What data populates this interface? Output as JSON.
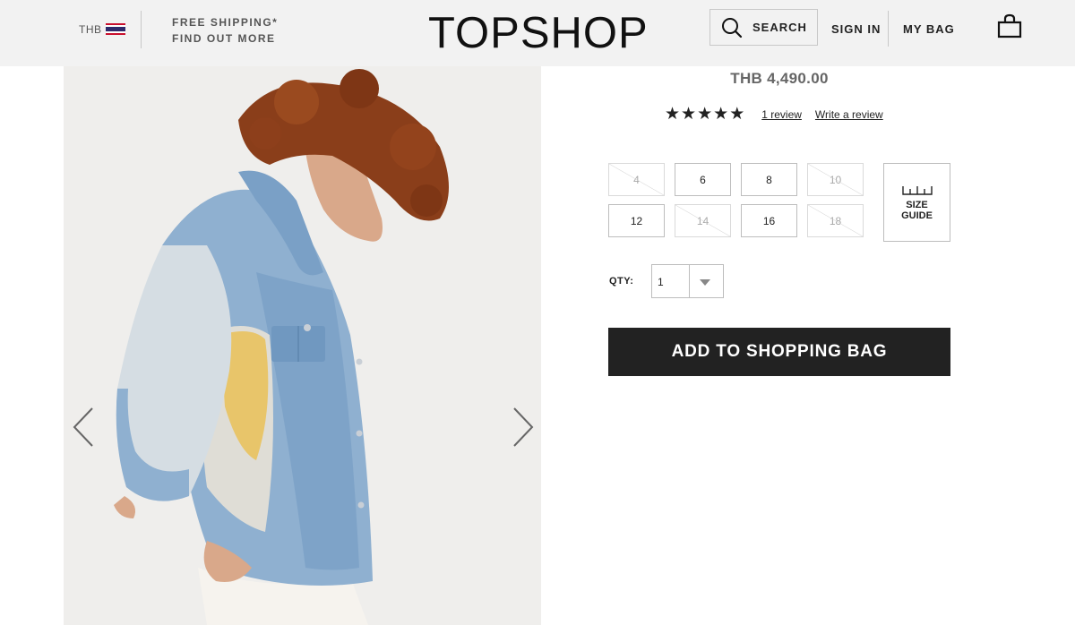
{
  "header": {
    "currency": "THB",
    "shipping_line1": "FREE SHIPPING*",
    "shipping_line2": "FIND OUT MORE",
    "logo": "TOPSHOP",
    "search_label": "SEARCH",
    "signin_label": "SIGN IN",
    "bag_label": "MY BAG",
    "icons": [
      "thai-flag-icon",
      "search-icon",
      "shopping-bag-icon"
    ]
  },
  "product": {
    "image_nav_icons": [
      "chevron-left-icon",
      "chevron-right-icon"
    ],
    "price": "THB 4,490.00",
    "rating": {
      "stars_filled": 5,
      "stars_total": 5
    },
    "review_count_label": "1 review",
    "write_review_label": "Write a review",
    "sizes": [
      {
        "label": "4",
        "available": false
      },
      {
        "label": "6",
        "available": true
      },
      {
        "label": "8",
        "available": true
      },
      {
        "label": "10",
        "available": false
      },
      {
        "label": "12",
        "available": true
      },
      {
        "label": "14",
        "available": false
      },
      {
        "label": "16",
        "available": true
      },
      {
        "label": "18",
        "available": false
      }
    ],
    "size_guide_label": "SIZE GUIDE",
    "qty_label": "QTY:",
    "qty_value": "1",
    "add_to_bag_label": "ADD TO SHOPPING BAG"
  },
  "colors": {
    "header_bg": "#f2f2f2",
    "button_dark": "#222222",
    "flag_red": "#c8102e",
    "flag_blue": "#2d2a6b"
  }
}
